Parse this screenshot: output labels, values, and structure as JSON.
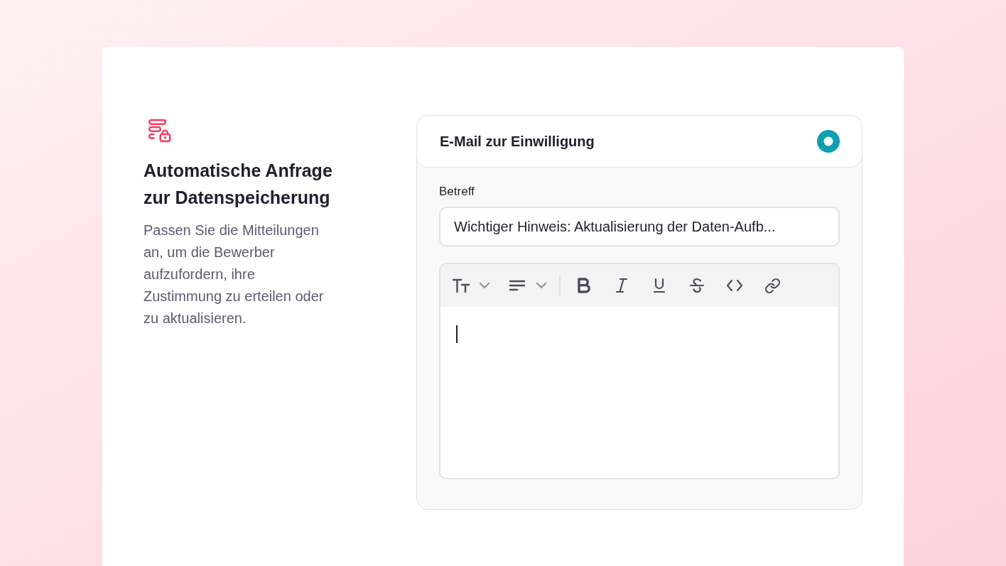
{
  "intro": {
    "title": "Automatische Anfrage zur Datenspeicherung",
    "description": "Passen Sie die Mitteilungen an, um die Bewerber aufzufordern, ihre Zustimmung zu erteilen oder zu aktualisieren."
  },
  "email_card": {
    "title": "E-Mail zur Einwilligung",
    "selected": true,
    "subject": {
      "label": "Betreff",
      "value": "Wichtiger Hinweis: Aktualisierung der Daten-Aufb..."
    },
    "editor": {
      "focused": true
    }
  }
}
